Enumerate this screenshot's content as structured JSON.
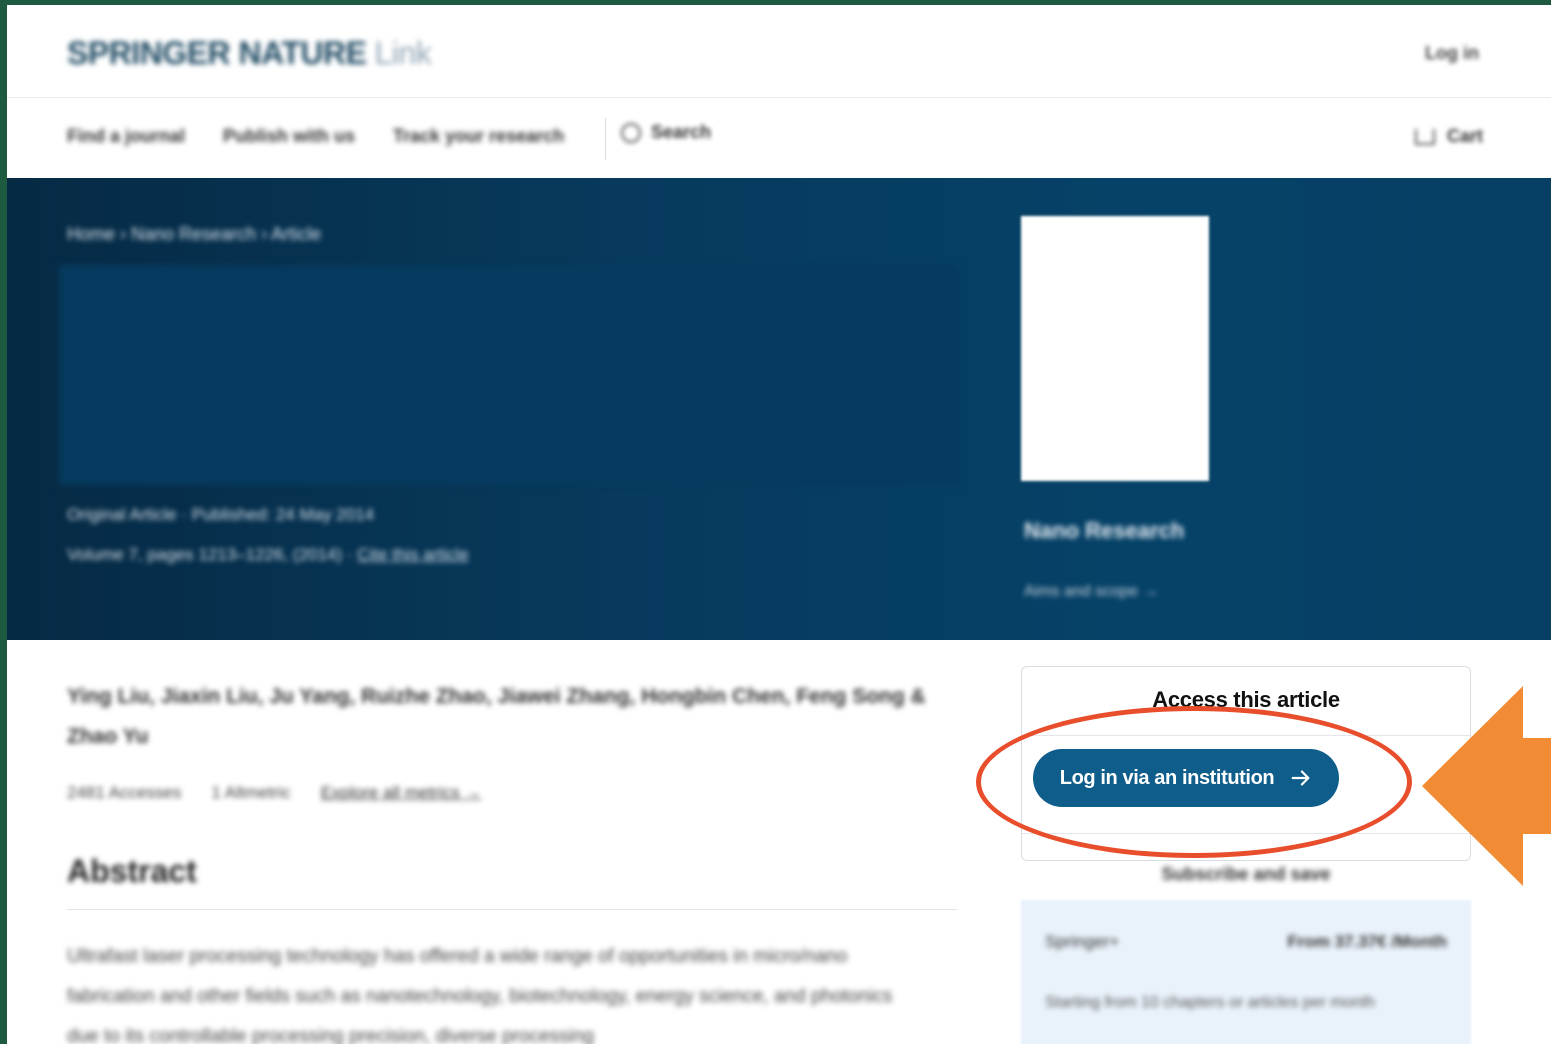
{
  "header": {
    "logo_main": "SPRINGER NATURE",
    "logo_link": "Link",
    "login": "Log in"
  },
  "nav": {
    "find_journal": "Find a journal",
    "publish": "Publish with us",
    "track": "Track your research",
    "search": "Search",
    "cart": "Cart"
  },
  "hero": {
    "breadcrumb": "Home › Nano Research › Article",
    "meta_line1": "Original Article · Published: 24 May 2014",
    "meta_line2": "Volume 7, pages 1213–1226, (2014)",
    "meta_link": "Cite this article",
    "journal_name": "Nano Research",
    "journal_link": "Aims and scope →"
  },
  "article": {
    "info": "Ying Liu, Jiaxin Liu, Ju Yang, Ruizhe Zhao, Jiawei Zhang, Hongbin Chen, Feng Song & Zhao Yu",
    "downloads": "2481 Accesses",
    "citations": "1 Altmetric",
    "metrics_link": "Explore all metrics →",
    "abstract_heading": "Abstract",
    "abstract_text": "Ultrafast laser processing technology has offered a wide range of opportunities in micro/nano fabrication and other fields such as nanotechnology, biotechnology, energy science, and photonics due to its controllable processing precision, diverse processing"
  },
  "access": {
    "title": "Access this article",
    "login_button": "Log in via an institution",
    "subscribe_title": "Subscribe and save",
    "publisher": "Springer+",
    "price": "From 37.37€ /Month",
    "bullet": "Starting from 10 chapters or articles per month"
  },
  "annotation": {
    "circle_color": "#e84e2b",
    "arrow_color": "#f28c34"
  }
}
